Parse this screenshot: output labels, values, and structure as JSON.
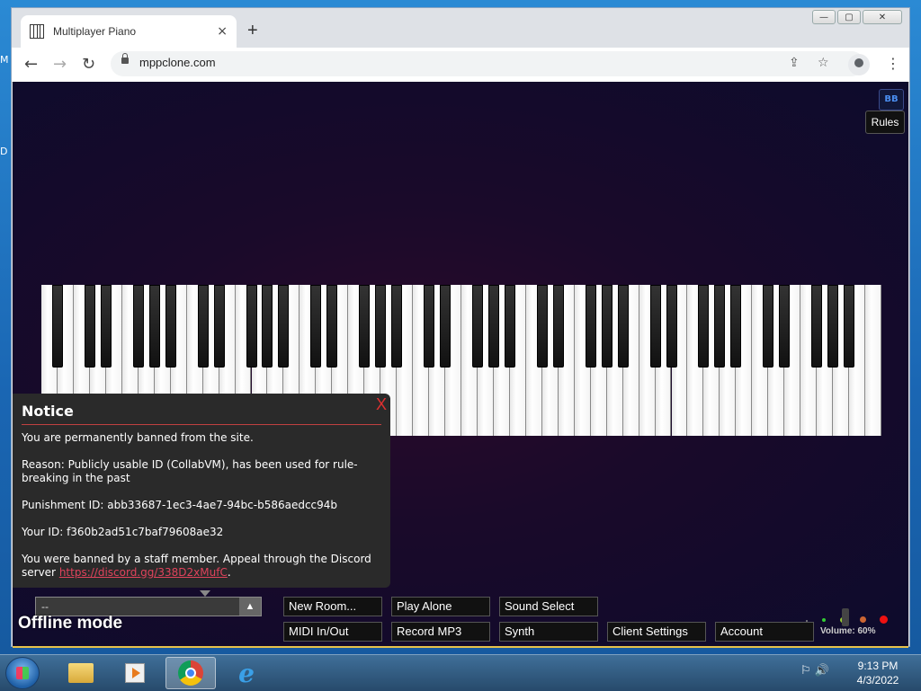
{
  "desktop": {
    "label_m": "M",
    "label_d": "D"
  },
  "browser": {
    "tab_title": "Multiplayer Piano",
    "tab_close": "×",
    "new_tab": "+",
    "url": "mppclone.com",
    "back": "←",
    "forward": "→",
    "reload": "↻",
    "share": "⇪",
    "star": "☆",
    "menu": "⋮",
    "min": "—",
    "max": "▢",
    "close": "✕"
  },
  "page": {
    "bb_icon": "BB",
    "rules": "Rules",
    "notice": {
      "title": "Notice",
      "close": "X",
      "line1": "You are permanently banned from the site.",
      "line2": "Reason: Publicly usable ID (CollabVM), has been used for rule-breaking in the past",
      "line3": "Punishment ID: abb33687-1ec3-4ae7-94bc-b586aedcc94b",
      "line4": "Your ID: f360b2ad51c7baf79608ae32",
      "line5_text": "You were banned by a staff member. Appeal through the Discord server ",
      "line5_link": "https://discord.gg/338D2xMufC",
      "line5_end": "."
    },
    "room_select": {
      "value": "--",
      "arrow": "▲"
    },
    "offline": "Offline mode",
    "buttons": {
      "new_room": "New Room...",
      "play_alone": "Play Alone",
      "sound_select": "Sound Select",
      "midi": "MIDI In/Out",
      "record": "Record MP3",
      "synth": "Synth",
      "client_settings": "Client Settings",
      "account": "Account"
    },
    "volume": {
      "label": "Volume: 60%",
      "level_percent": 60
    }
  },
  "taskbar": {
    "tray_icons": "⚐ 🔊",
    "time": "9:13 PM",
    "date": "4/3/2022",
    "ie_glyph": "e"
  },
  "colors": {
    "accent_red": "#e03030",
    "link": "#e0435c",
    "page_bg": "#0d0b2c"
  }
}
